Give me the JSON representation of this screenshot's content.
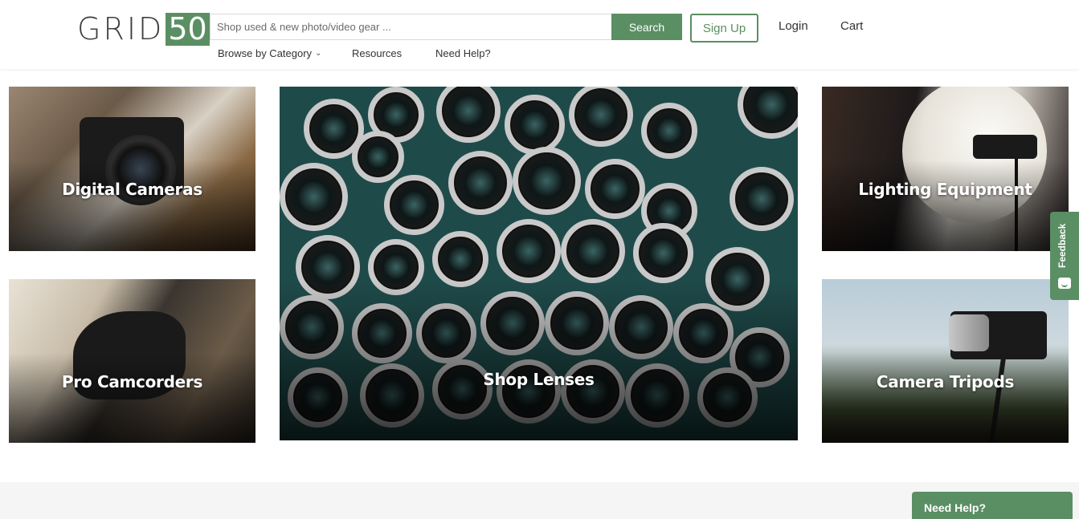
{
  "header": {
    "logo_text": "GRID",
    "logo_number": "50",
    "search_placeholder": "Shop used & new photo/video gear ...",
    "search_button": "Search",
    "signup_button": "Sign Up",
    "login_link": "Login",
    "cart_link": "Cart"
  },
  "subnav": {
    "browse": "Browse by Category",
    "resources": "Resources",
    "need_help": "Need Help?"
  },
  "tiles": [
    {
      "label": "Digital Cameras"
    },
    {
      "label": "Shop Lenses"
    },
    {
      "label": "Lighting Equipment"
    },
    {
      "label": "Pro Camcorders"
    },
    {
      "label": "Camera Tripods"
    }
  ],
  "feedback_label": "Feedback",
  "help_widget": "Need Help?",
  "colors": {
    "brand_green": "#5a8f63"
  }
}
